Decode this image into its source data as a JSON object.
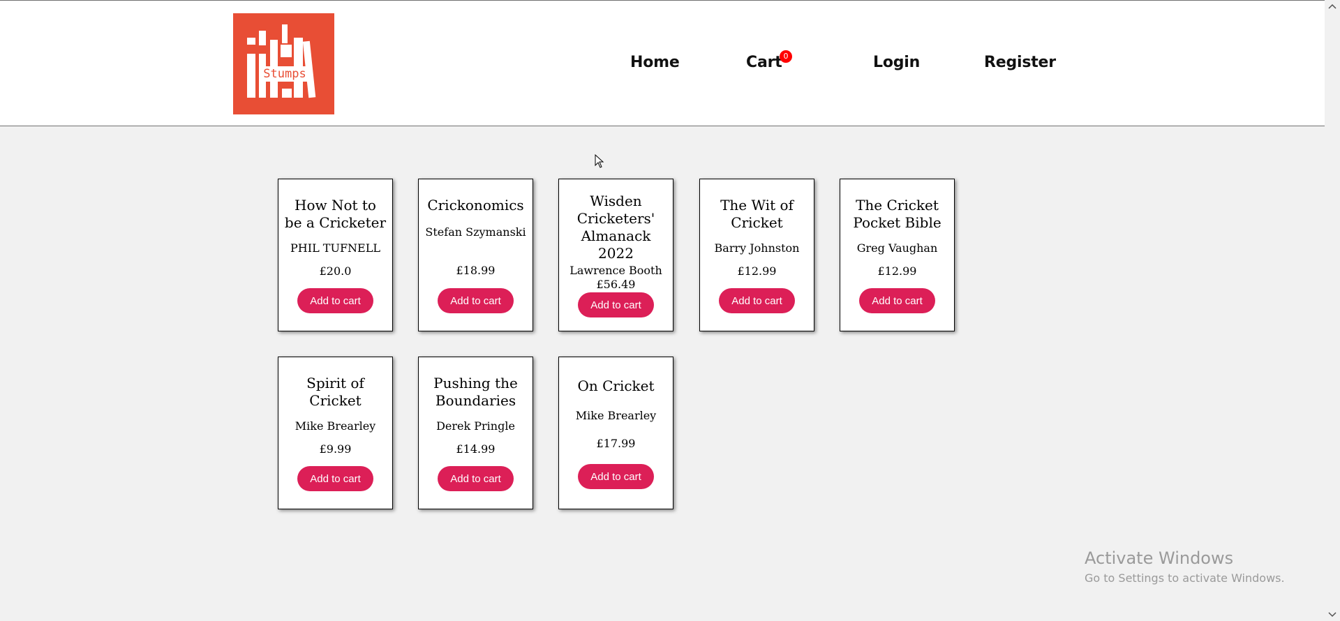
{
  "logo": {
    "text": "Stumps",
    "color": "#e84e35"
  },
  "nav": {
    "home": "Home",
    "cart": "Cart",
    "cart_count": "0",
    "login": "Login",
    "register": "Register"
  },
  "colors": {
    "button": "#dc1f57",
    "badge": "#ff0000",
    "background": "#f1f1f1"
  },
  "products": [
    {
      "title": "How Not to be a Cricketer",
      "author": "PHIL TUFNELL",
      "price": "£20.0",
      "button": "Add to cart"
    },
    {
      "title": "Crickonomics",
      "author": "Stefan Szymanski",
      "price": "£18.99",
      "button": "Add to cart"
    },
    {
      "title": "Wisden Cricketers' Almanack 2022",
      "author": "Lawrence Booth",
      "price": "£56.49",
      "button": "Add to cart"
    },
    {
      "title": "The Wit of Cricket",
      "author": "Barry Johnston",
      "price": "£12.99",
      "button": "Add to cart"
    },
    {
      "title": "The Cricket Pocket Bible",
      "author": "Greg Vaughan",
      "price": "£12.99",
      "button": "Add to cart"
    },
    {
      "title": "Spirit of Cricket",
      "author": "Mike Brearley",
      "price": "£9.99",
      "button": "Add to cart"
    },
    {
      "title": "Pushing the Boundaries",
      "author": "Derek Pringle",
      "price": "£14.99",
      "button": "Add to cart"
    },
    {
      "title": "On Cricket",
      "author": "Mike Brearley",
      "price": "£17.99",
      "button": "Add to cart"
    }
  ],
  "watermark": {
    "title": "Activate Windows",
    "subtitle": "Go to Settings to activate Windows."
  }
}
